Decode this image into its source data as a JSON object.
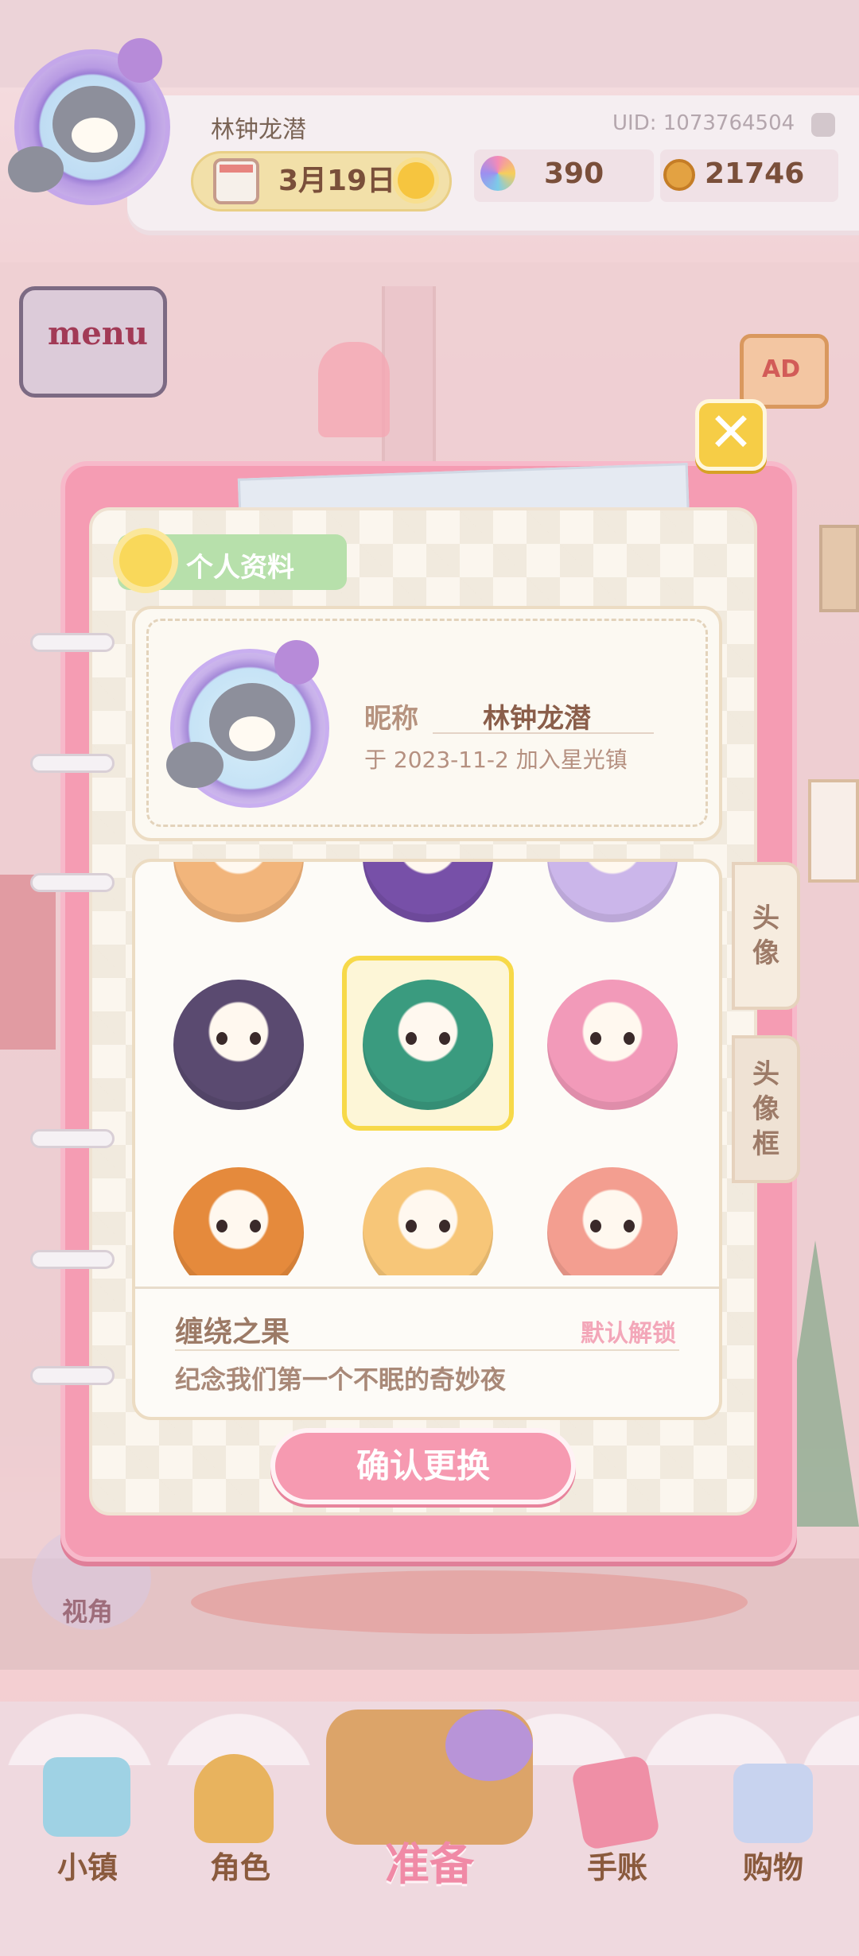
{
  "hud": {
    "username": "林钟龙潜",
    "uid": "UID: 1073764504",
    "date": "3月19日",
    "gems": "390",
    "coins": "21746"
  },
  "buttons": {
    "menu": "menu",
    "ad": "AD",
    "view": "视角",
    "close": "✕"
  },
  "dialog": {
    "title": "个人资料",
    "nickname_label": "昵称",
    "nickname_value": "林钟龙潜",
    "join_text": "于 2023-11-2 加入星光镇",
    "tabs": [
      {
        "chars": [
          "头",
          "像"
        ]
      },
      {
        "chars": [
          "头",
          "像",
          "框"
        ]
      }
    ],
    "selected_item": {
      "name": "缠绕之果",
      "status": "默认解锁",
      "description": "纪念我们第一个不眠的奇妙夜"
    },
    "avatars": [
      {
        "name": "dog-avatar",
        "color": "#f2b57b"
      },
      {
        "name": "black-cat-avatar",
        "color": "#7750a8"
      },
      {
        "name": "purple-ghost-avatar",
        "color": "#cbb6ea"
      },
      {
        "name": "reaper-avatar",
        "color": "#5a4a70"
      },
      {
        "name": "mummy-avatar",
        "color": "#3a9b7f"
      },
      {
        "name": "pink-bat-avatar",
        "color": "#f29ab9"
      },
      {
        "name": "pumpkin-avatar",
        "color": "#e58a3c"
      },
      {
        "name": "hamster-avatar",
        "color": "#f7c678"
      },
      {
        "name": "cream-hamster-avatar",
        "color": "#f39e90"
      }
    ],
    "confirm": "确认更换"
  },
  "nav": [
    {
      "label": "小镇",
      "icon": "map-icon"
    },
    {
      "label": "角色",
      "icon": "character-icon"
    },
    {
      "label": "准备",
      "icon": "basket-icon"
    },
    {
      "label": "手账",
      "icon": "journal-icon"
    },
    {
      "label": "购物",
      "icon": "shopping-bag-icon"
    }
  ],
  "colors": {
    "dialog_frame": "#f59cb3",
    "selection": "#f7d949",
    "accent_text": "#8a5e4a"
  }
}
